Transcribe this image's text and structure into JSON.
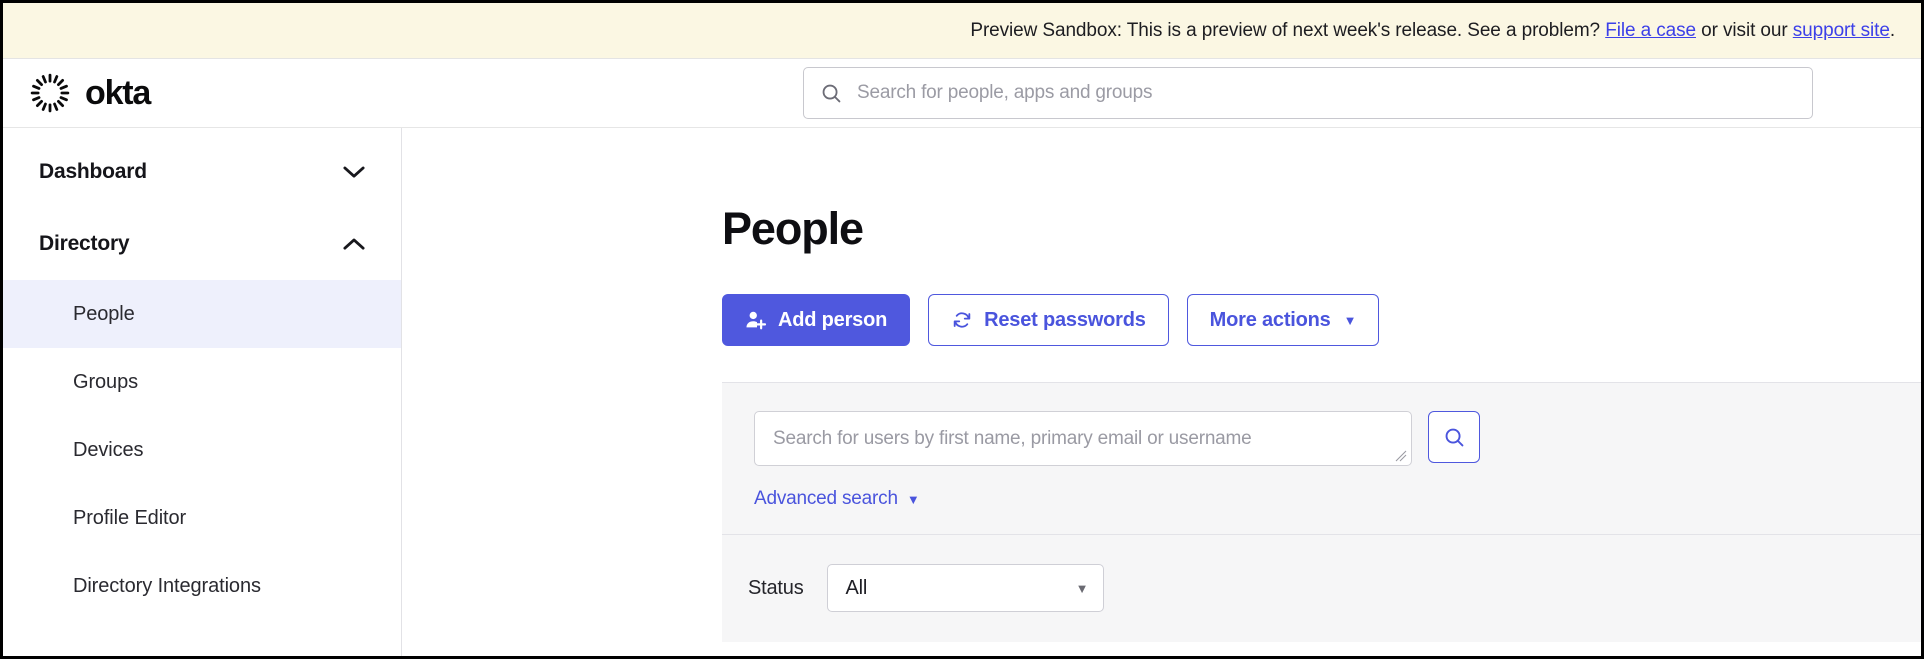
{
  "banner": {
    "text_before": "Preview Sandbox: This is a preview of next week's release. See a problem? ",
    "link1": "File a case",
    "text_mid": " or visit our ",
    "link2": "support site",
    "text_end": ".",
    "background": "#FBF7E3",
    "link_color": "#3C40E8"
  },
  "topbar": {
    "brand_name": "okta",
    "logo_icon": "okta-burst-icon",
    "search": {
      "icon": "search-icon",
      "placeholder": "Search for people, apps and groups",
      "value": ""
    }
  },
  "sidebar": {
    "groups": [
      {
        "label": "Dashboard",
        "icon": "chevron-down-icon",
        "expanded": false
      },
      {
        "label": "Directory",
        "icon": "chevron-up-icon",
        "expanded": true
      }
    ],
    "items": [
      {
        "label": "People",
        "active": true
      },
      {
        "label": "Groups",
        "active": false
      },
      {
        "label": "Devices",
        "active": false
      },
      {
        "label": "Profile Editor",
        "active": false
      },
      {
        "label": "Directory Integrations",
        "active": false
      }
    ],
    "active_background": "#EEF0FC"
  },
  "main": {
    "page_title": "People",
    "actions": [
      {
        "label": "Add person",
        "icon": "person-add-icon",
        "style": "primary"
      },
      {
        "label": "Reset passwords",
        "icon": "refresh-icon",
        "style": "outline"
      },
      {
        "label": "More actions",
        "icon": "caret-down-icon",
        "style": "outline"
      }
    ],
    "accent_color": "#4F58DE",
    "filters": {
      "panel_background": "#F6F6F7",
      "user_search": {
        "placeholder": "Search for users by first name, primary email or username",
        "value": "",
        "resize_handle": "resize-grip-icon"
      },
      "search_button_icon": "search-icon",
      "advanced_search_label": "Advanced search",
      "advanced_search_caret": "caret-down-icon",
      "status": {
        "label": "Status",
        "selected": "All",
        "caret": "caret-down-icon"
      }
    }
  }
}
